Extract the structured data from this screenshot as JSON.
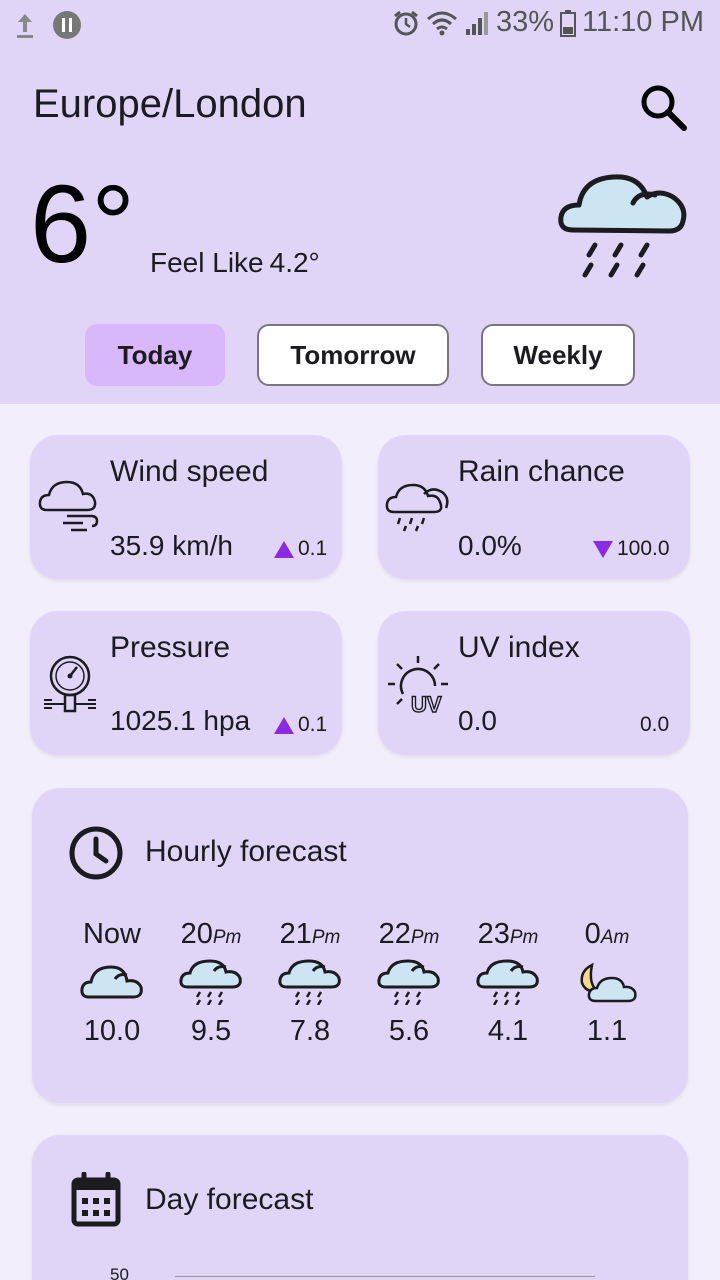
{
  "status_bar": {
    "battery_percent": "33%",
    "time": "11:10 PM"
  },
  "header": {
    "location": "Europe/London",
    "temperature": "6°",
    "feels_like_label": "Feel Like",
    "feels_like_value": "4.2°",
    "condition_icon": "cloud-rain-icon"
  },
  "tabs": [
    {
      "label": "Today",
      "active": true
    },
    {
      "label": "Tomorrow",
      "active": false
    },
    {
      "label": "Weekly",
      "active": false
    }
  ],
  "stats": {
    "wind": {
      "title": "Wind speed",
      "value": "35.9 km/h",
      "change": "0.1",
      "direction": "up",
      "icon": "wind-cloud-icon"
    },
    "rain": {
      "title": "Rain chance",
      "value": "0.0%",
      "change": "100.0",
      "direction": "down",
      "icon": "rain-cloud-icon"
    },
    "pressure": {
      "title": "Pressure",
      "value": "1025.1 hpa",
      "change": "0.1",
      "direction": "up",
      "icon": "barometer-icon"
    },
    "uv": {
      "title": "UV index",
      "value": "0.0",
      "change": "0.0",
      "direction": "none",
      "icon": "uv-sun-icon"
    }
  },
  "hourly": {
    "title": "Hourly forecast",
    "items": [
      {
        "hour": "Now",
        "suffix": "",
        "temp": "10.0",
        "icon": "cloud-icon"
      },
      {
        "hour": "20",
        "suffix": "Pm",
        "temp": "9.5",
        "icon": "cloud-rain-icon"
      },
      {
        "hour": "21",
        "suffix": "Pm",
        "temp": "7.8",
        "icon": "cloud-rain-icon"
      },
      {
        "hour": "22",
        "suffix": "Pm",
        "temp": "5.6",
        "icon": "cloud-rain-icon"
      },
      {
        "hour": "23",
        "suffix": "Pm",
        "temp": "4.1",
        "icon": "cloud-rain-icon"
      },
      {
        "hour": "0",
        "suffix": "Am",
        "temp": "1.1",
        "icon": "moon-cloud-icon"
      }
    ]
  },
  "day_forecast": {
    "title": "Day forecast",
    "y_tick": "50"
  },
  "colors": {
    "header_bg": "#e1d5f7",
    "page_bg": "#f3eefc",
    "accent": "#8a2be2",
    "active_tab": "#d8b8fb",
    "icon_fill": "#cde4f2"
  }
}
